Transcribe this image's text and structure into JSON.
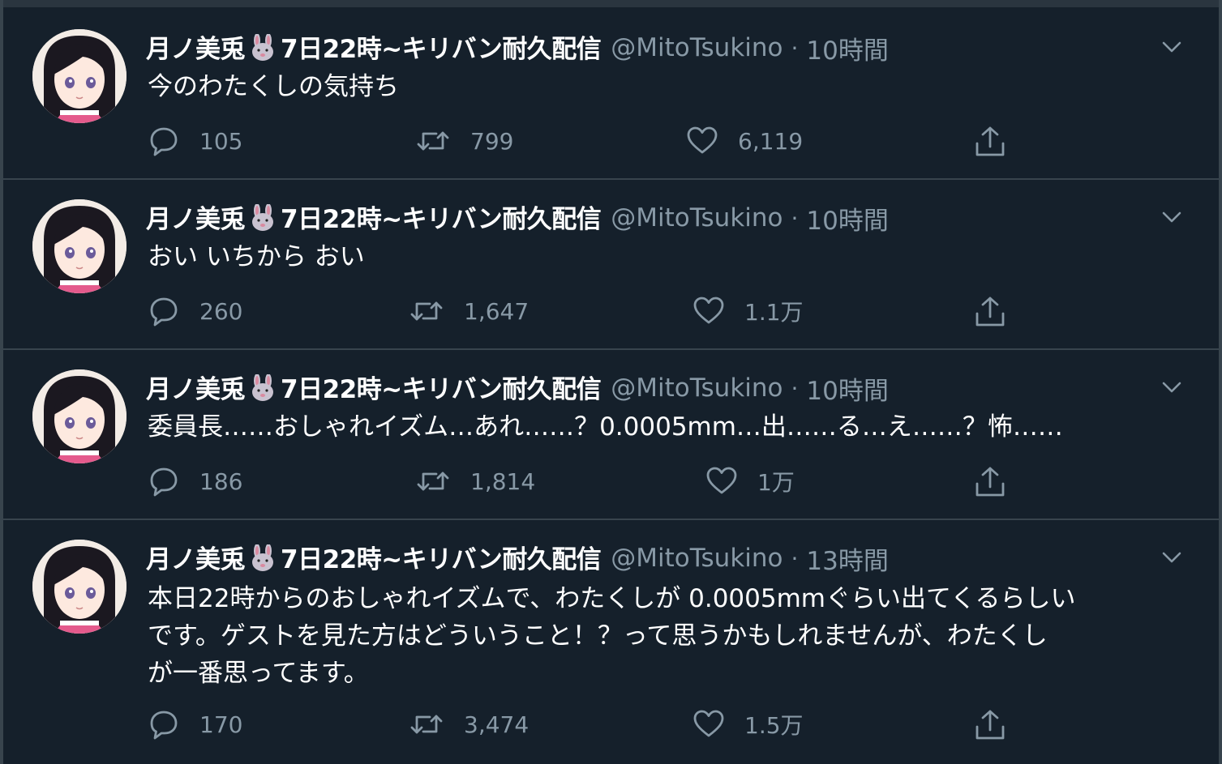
{
  "tweets": [
    {
      "name": "月ノ美兎",
      "name_suffix": "7日22時~キリバン耐久配信",
      "handle": "@MitoTsukino",
      "separator": "·",
      "time": "10時間",
      "text": "今のわたくしの気持ち",
      "replies": "105",
      "retweets": "799",
      "likes": "6,119"
    },
    {
      "name": "月ノ美兎",
      "name_suffix": "7日22時~キリバン耐久配信",
      "handle": "@MitoTsukino",
      "separator": "·",
      "time": "10時間",
      "text": "おい いちから おい",
      "replies": "260",
      "retweets": "1,647",
      "likes": "1.1万"
    },
    {
      "name": "月ノ美兎",
      "name_suffix": "7日22時~キリバン耐久配信",
      "handle": "@MitoTsukino",
      "separator": "·",
      "time": "10時間",
      "text": "委員長……おしゃれイズム…あれ……？0.0005mm…出……る…え……？怖……",
      "replies": "186",
      "retweets": "1,814",
      "likes": "1万"
    },
    {
      "name": "月ノ美兎",
      "name_suffix": "7日22時~キリバン耐久配信",
      "handle": "@MitoTsukino",
      "separator": "·",
      "time": "13時間",
      "text_lines": [
        "本日22時からのおしゃれイズムで、わたくしが 0.0005mmぐらい出てくるらしい",
        "です。ゲストを見た方はどういうこと！？って思うかもしれませんが、わたくし",
        "が一番思ってます。"
      ],
      "replies": "170",
      "retweets": "3,474",
      "likes": "1.5万"
    }
  ],
  "icons": {
    "reply": "reply-icon",
    "retweet": "retweet-icon",
    "like": "heart-icon",
    "share": "share-icon",
    "menu": "chevron-down-icon",
    "name_emoji": "rabbit-face-icon"
  },
  "colors": {
    "background": "#15202b",
    "border": "#38444d",
    "primary_text": "#ffffff",
    "secondary_text": "#8899a6"
  }
}
